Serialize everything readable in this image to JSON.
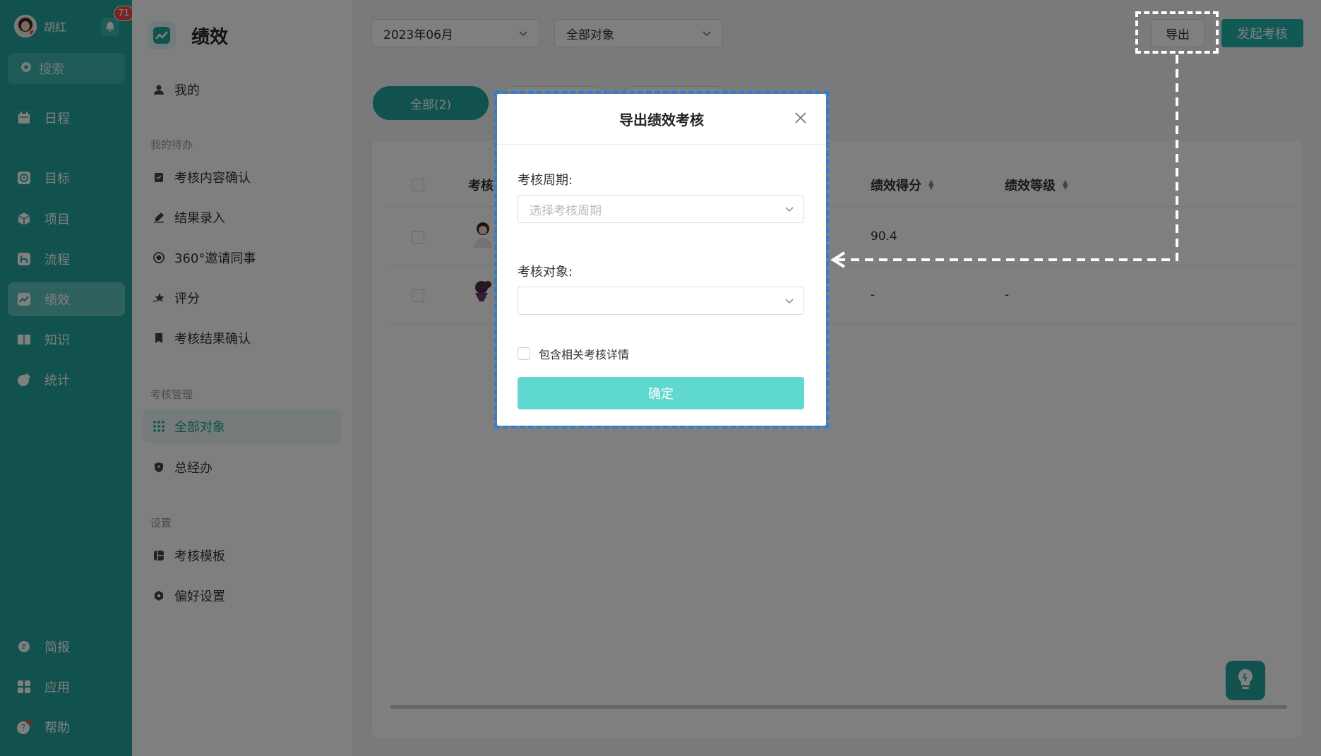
{
  "user": {
    "name": "胡红",
    "notification_count": "71"
  },
  "sidebar": {
    "search_label": "搜索",
    "items": [
      {
        "label": "日程",
        "icon": "calendar-icon"
      },
      {
        "label": "目标",
        "icon": "target-icon"
      },
      {
        "label": "项目",
        "icon": "cube-icon"
      },
      {
        "label": "流程",
        "icon": "flow-icon"
      },
      {
        "label": "绩效",
        "icon": "chart-icon",
        "active": true
      },
      {
        "label": "知识",
        "icon": "book-icon"
      },
      {
        "label": "统计",
        "icon": "pie-icon"
      },
      {
        "label": "简报",
        "icon": "report-icon"
      },
      {
        "label": "应用",
        "icon": "apps-icon"
      },
      {
        "label": "帮助",
        "icon": "help-icon"
      }
    ]
  },
  "menu": {
    "title": "绩效",
    "mine": "我的",
    "sections": {
      "todo": "我的待办",
      "manage": "考核管理",
      "settings": "设置"
    },
    "todo_items": [
      "考核内容确认",
      "结果录入",
      "360°邀请同事",
      "评分",
      "考核结果确认"
    ],
    "manage_items": [
      "全部对象",
      "总经办"
    ],
    "settings_items": [
      "考核模板",
      "偏好设置"
    ]
  },
  "toolbar": {
    "period": "2023年06月",
    "object_filter": "全部对象",
    "export": "导出",
    "start_review": "发起考核"
  },
  "tabs": {
    "all": "全部(2)"
  },
  "table": {
    "headers": {
      "target": "考核",
      "score": "绩效得分",
      "grade": "绩效等级"
    },
    "rows": [
      {
        "score": "90.4",
        "grade": ""
      },
      {
        "score": "-",
        "grade": "-"
      }
    ]
  },
  "dialog": {
    "title": "导出绩效考核",
    "period_label": "考核周期:",
    "period_placeholder": "选择考核周期",
    "object_label": "考核对象:",
    "object_value": "",
    "include_details": "包含相关考核详情",
    "confirm": "确定"
  },
  "colors": {
    "brand": "#23a49c",
    "annotation_blue": "#2f7fd1",
    "confirm_button": "#5fd9d0"
  }
}
